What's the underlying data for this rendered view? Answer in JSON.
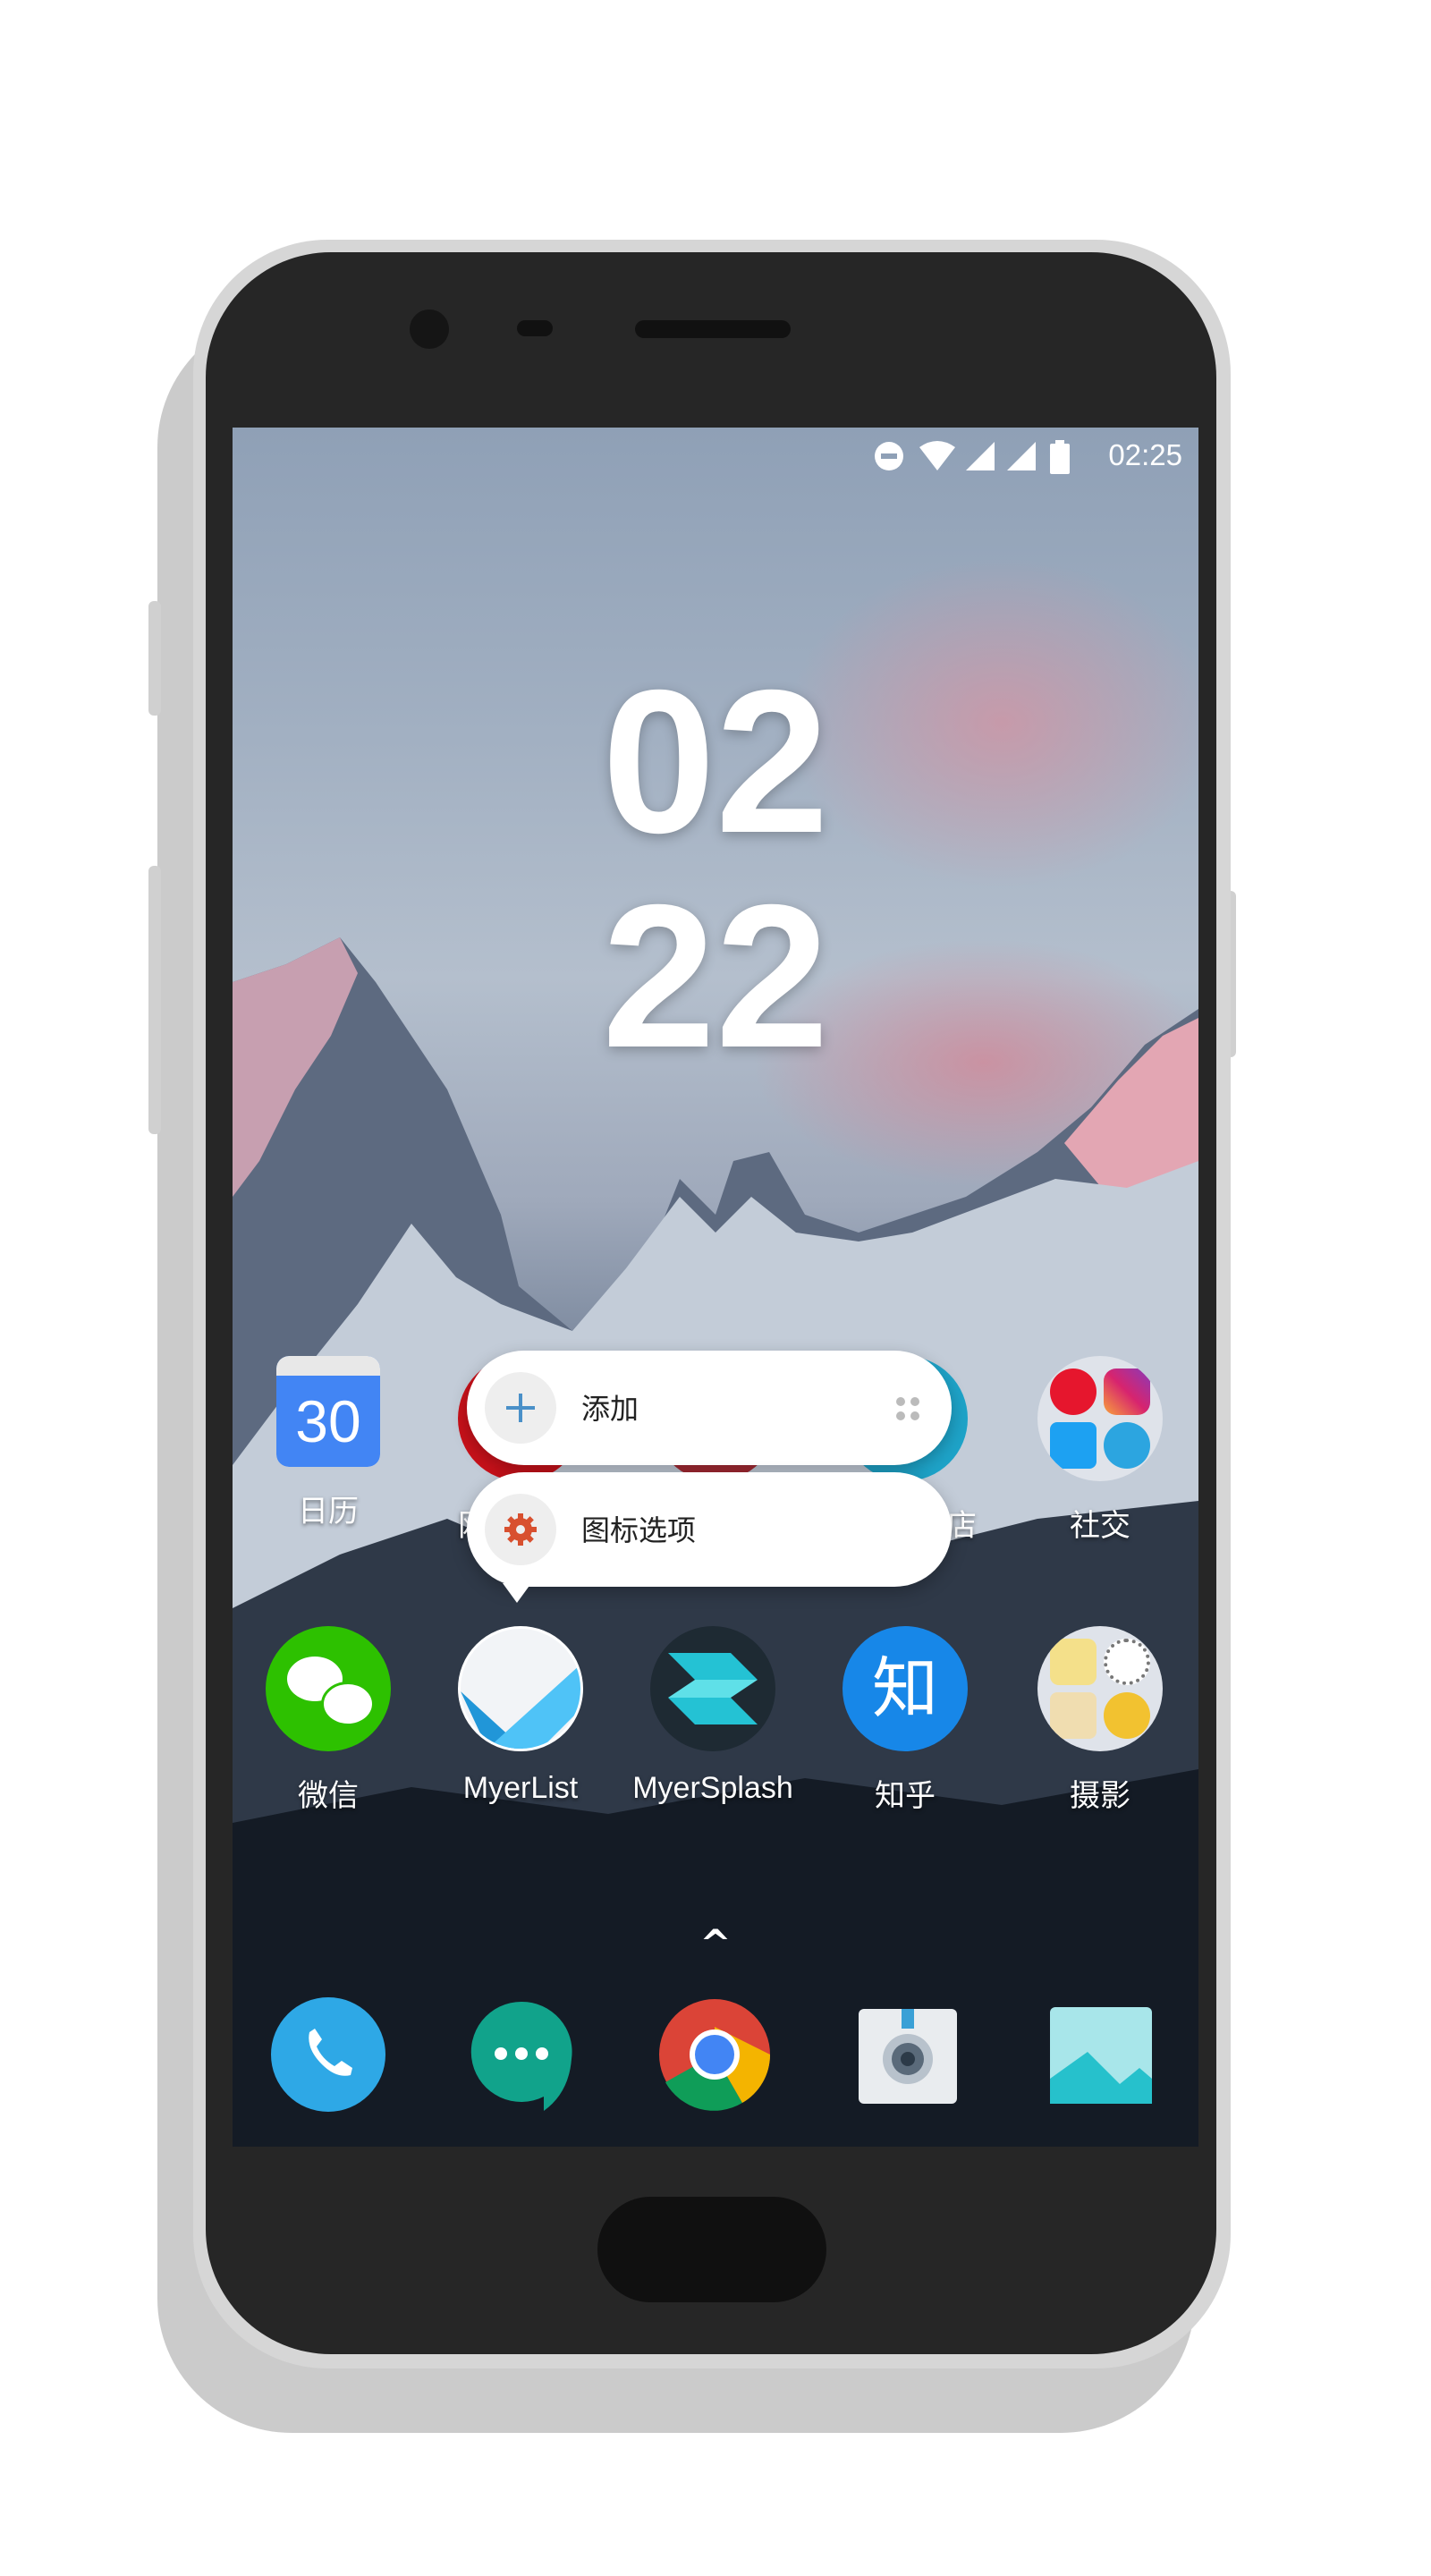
{
  "status_bar": {
    "time": "02:25",
    "icons": [
      "do-not-disturb-icon",
      "wifi-icon",
      "signal-icon",
      "signal-icon",
      "battery-icon"
    ]
  },
  "clock": {
    "hours": "02",
    "minutes": "22"
  },
  "row1_apps": [
    {
      "label": "日历",
      "icon": "calendar-icon",
      "date": "30"
    },
    {
      "label": "网",
      "icon": "hidden-app-icon"
    },
    {
      "label": "",
      "icon": "hidden-app-icon"
    },
    {
      "label": "店",
      "icon": "hidden-app-icon"
    },
    {
      "label": "社交",
      "icon": "social-folder-icon"
    }
  ],
  "row2_apps": [
    {
      "label": "微信",
      "icon": "wechat-icon"
    },
    {
      "label": "MyerList",
      "icon": "myerlist-icon"
    },
    {
      "label": "MyerSplash",
      "icon": "myersplash-icon"
    },
    {
      "label": "知乎",
      "icon": "zhihu-icon",
      "glyph": "知"
    },
    {
      "label": "摄影",
      "icon": "photography-folder-icon"
    }
  ],
  "popup_menu": {
    "items": [
      {
        "label": "添加",
        "icon": "plus-icon"
      },
      {
        "label": "图标选项",
        "icon": "gear-icon"
      }
    ]
  },
  "app_drawer_arrow": "^",
  "dock": [
    {
      "icon": "phone-icon"
    },
    {
      "icon": "hangouts-icon"
    },
    {
      "icon": "chrome-icon"
    },
    {
      "icon": "camera-icon"
    },
    {
      "icon": "gallery-icon"
    }
  ],
  "colors": {
    "wechat": "#2dc100",
    "zhihu": "#1787e8",
    "calendar": "#4285f4",
    "phone": "#2ea8e6",
    "hangouts": "#11a38b",
    "gear": "#d8502f",
    "plus": "#4a90c8"
  }
}
